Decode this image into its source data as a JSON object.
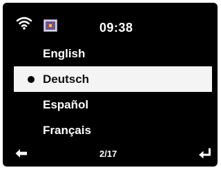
{
  "status_bar": {
    "time": "09:38",
    "wifi_icon": "wifi-icon",
    "station_icon": "station-icon"
  },
  "language_menu": {
    "items": [
      {
        "label": "English",
        "selected": false
      },
      {
        "label": "Deutsch",
        "selected": true
      },
      {
        "label": "Español",
        "selected": false
      },
      {
        "label": "Français",
        "selected": false
      }
    ]
  },
  "footer": {
    "page_indicator": "2/17",
    "back_icon": "back-arrow-icon",
    "enter_icon": "enter-icon"
  },
  "colors": {
    "screen_background": "#000000",
    "text": "#ffffff",
    "highlight_background": "#f4f4f4",
    "highlight_text": "#111111"
  }
}
